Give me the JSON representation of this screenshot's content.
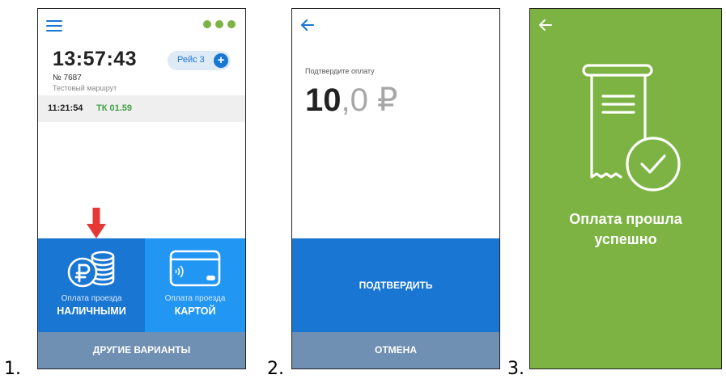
{
  "steps": {
    "one": "1.",
    "two": "2.",
    "three": "3."
  },
  "screen1": {
    "menu_icon": "hamburger-menu-icon",
    "status_icon": "three-dots-icon",
    "clock": "13:57:43",
    "route_number": "№ 7687",
    "route_name": "Тестовый маршрут",
    "trip_label": "Рейс 3",
    "trip_add": "+",
    "row_time": "11:21:54",
    "row_code": "ТК 01.59",
    "pay_cash": {
      "small": "Оплата проезда",
      "big": "НАЛИЧНЫМИ",
      "icon": "coins-ruble-icon"
    },
    "pay_card": {
      "small": "Оплата проезда",
      "big": "КАРТОЙ",
      "icon": "nfc-card-icon"
    },
    "other_options": "ДРУГИЕ ВАРИАНТЫ",
    "arrow_icon": "red-down-arrow-icon"
  },
  "screen2": {
    "back_icon": "back-arrow-icon",
    "confirm_label": "Подтвердите оплату",
    "amount_int": "10",
    "amount_dec": ",0 ₽",
    "confirm_button": "ПОДТВЕРДИТЬ",
    "cancel_button": "ОТМЕНА"
  },
  "screen3": {
    "back_icon": "back-arrow-icon",
    "success_line1": "Оплата прошла",
    "success_line2": "успешно",
    "receipt_icon": "receipt-check-icon"
  },
  "colors": {
    "primary_blue": "#1976d2",
    "light_blue": "#2196f3",
    "gray_blue": "#6f8fb3",
    "green": "#7cb342",
    "code_green": "#43a047",
    "arrow_red": "#e53935"
  }
}
